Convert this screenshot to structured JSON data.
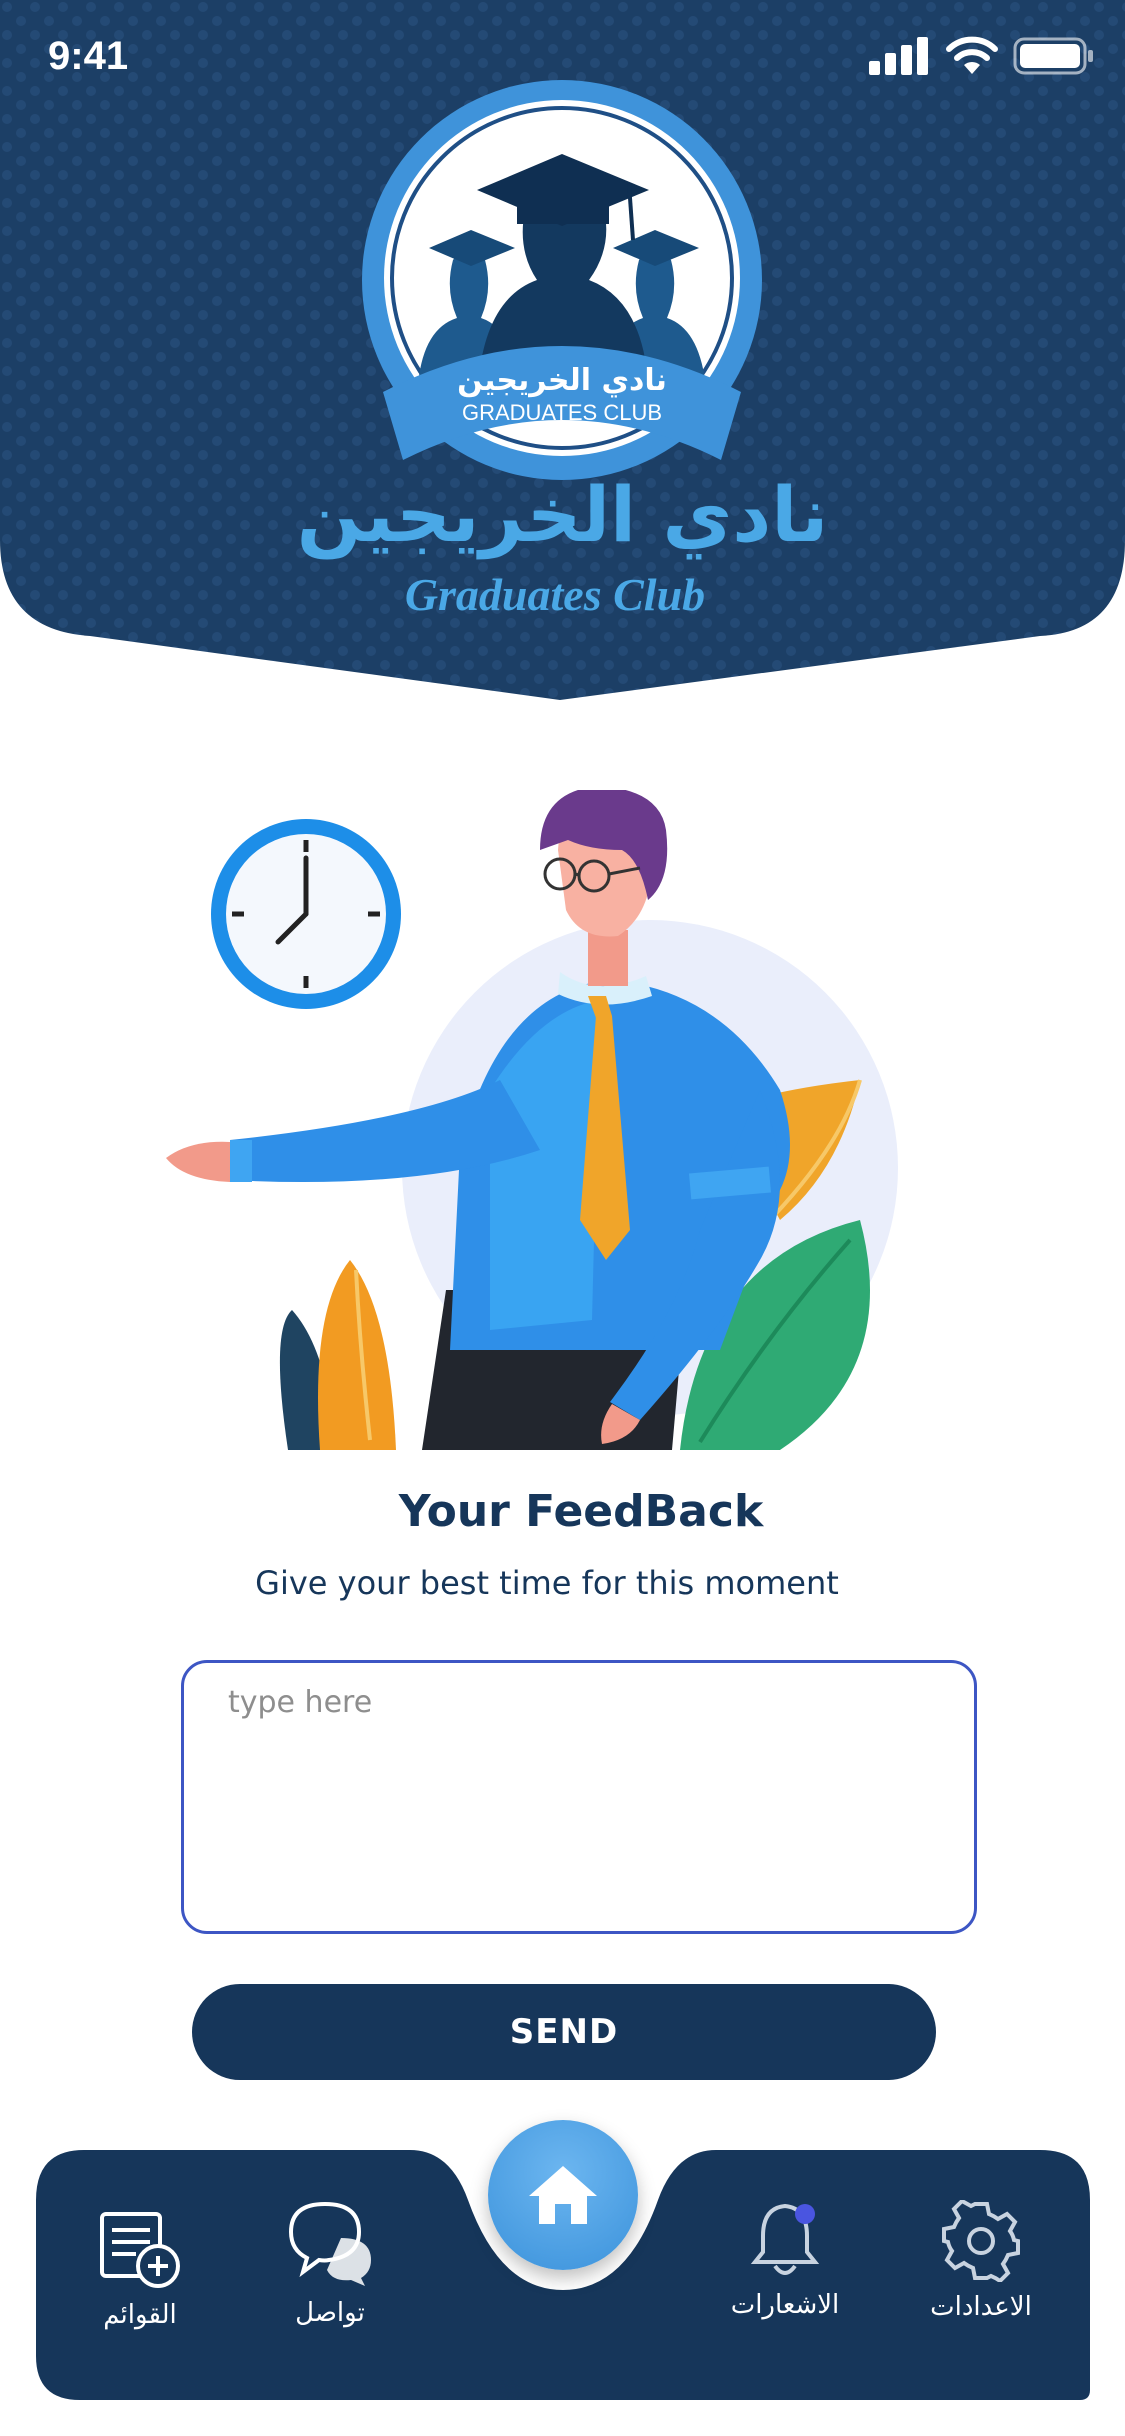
{
  "status_bar": {
    "time": "9:41"
  },
  "header": {
    "logo_text_ar": "نادي الخريجين",
    "logo_text_en": "GRADUATES CLUB",
    "title_ar": "نادي الخريجين",
    "title_en": "Graduates Club"
  },
  "feedback": {
    "title": "Your FeedBack",
    "subtitle": "Give your best time for this moment",
    "input_placeholder": "type here",
    "input_value": "",
    "send_label": "SEND"
  },
  "bottom_nav": {
    "items": [
      {
        "label": "القوائم",
        "icon": "list-add-icon"
      },
      {
        "label": "تواصل",
        "icon": "chat-bubbles-icon"
      },
      {
        "label": "",
        "icon": "home-icon"
      },
      {
        "label": "الاشعارات",
        "icon": "bell-icon"
      },
      {
        "label": "الاعدادات",
        "icon": "gear-icon"
      }
    ]
  },
  "colors": {
    "navy": "#16365a",
    "accent_blue": "#4aa8e6",
    "input_border": "#3d56c4",
    "notification_dot": "#4a55e0"
  }
}
